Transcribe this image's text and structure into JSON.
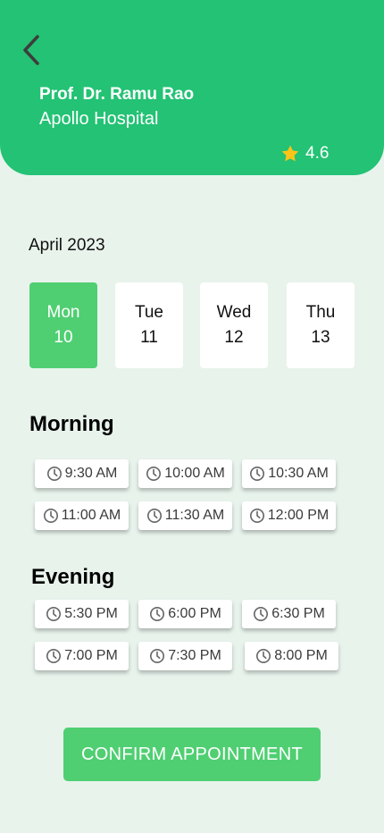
{
  "header": {
    "doctor_name": "Prof. Dr. Ramu Rao",
    "hospital": "Apollo Hospital",
    "rating": "4.6",
    "back_icon": "chevron-left-icon",
    "rating_icon": "star-icon",
    "colors": {
      "background": "#23c274",
      "star": "#fcc419"
    }
  },
  "calendar": {
    "month": "April 2023",
    "dates": [
      {
        "day": "Mon",
        "num": "10",
        "selected": true
      },
      {
        "day": "Tue",
        "num": "11",
        "selected": false
      },
      {
        "day": "Wed",
        "num": "12",
        "selected": false
      },
      {
        "day": "Thu",
        "num": "13",
        "selected": false
      }
    ],
    "colors": {
      "selected": "#4fcf72"
    }
  },
  "morning": {
    "title": "Morning",
    "slots": [
      "9:30 AM",
      "10:00 AM",
      "10:30 AM",
      "11:00 AM",
      "11:30 AM",
      "12:00 PM"
    ]
  },
  "evening": {
    "title": "Evening",
    "slots": [
      "5:30 PM",
      "6:00 PM",
      "6:30 PM",
      "7:00 PM",
      "7:30 PM",
      "8:00 PM"
    ]
  },
  "slot_icon": "clock-icon",
  "confirm": {
    "label": "CONFIRM APPOINTMENT",
    "color": "#4fcf72"
  }
}
